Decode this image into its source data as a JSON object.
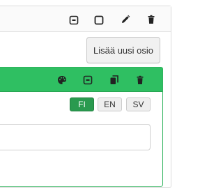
{
  "outer_toolbar": {
    "icons": [
      "collapse-icon",
      "expand-icon",
      "edit-icon",
      "delete-icon"
    ]
  },
  "add_section_button": {
    "label": "Lisää uusi osio"
  },
  "section_toolbar": {
    "color": "#2fbf62",
    "icons": [
      "palette-icon",
      "collapse-icon",
      "copy-icon",
      "delete-icon"
    ]
  },
  "languages": {
    "selected": "FI",
    "items": [
      {
        "code": "FI",
        "active": true
      },
      {
        "code": "EN",
        "active": false
      },
      {
        "code": "SV",
        "active": false
      }
    ]
  },
  "text_field": {
    "value": ""
  }
}
